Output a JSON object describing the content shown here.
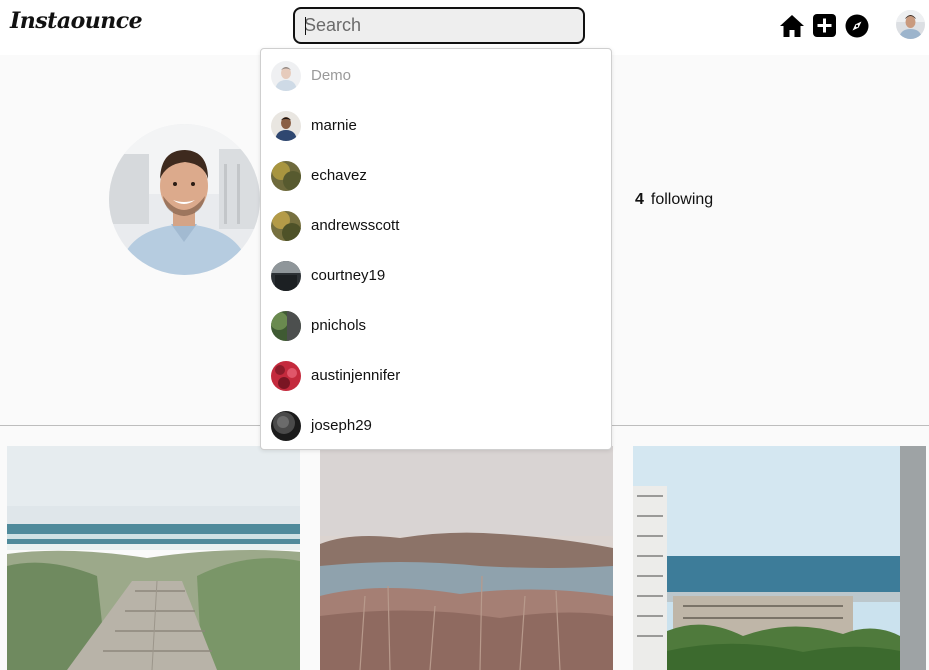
{
  "header": {
    "logo": "Instaounce",
    "search": {
      "placeholder": "Search",
      "value": ""
    },
    "nav": [
      {
        "icon": "home-icon"
      },
      {
        "icon": "add-post-icon"
      },
      {
        "icon": "explore-compass-icon"
      },
      {
        "icon": "profile-avatar"
      }
    ]
  },
  "profile": {
    "following_count": "4",
    "following_label": "following"
  },
  "search_results": [
    {
      "username": "Demo",
      "muted": true
    },
    {
      "username": "marnie"
    },
    {
      "username": "echavez"
    },
    {
      "username": "andrewsscott"
    },
    {
      "username": "courtney19"
    },
    {
      "username": "pnichols"
    },
    {
      "username": "austinjennifer"
    },
    {
      "username": "joseph29"
    }
  ],
  "posts": [
    {
      "subject": "beach boardwalk"
    },
    {
      "subject": "lake and hills"
    },
    {
      "subject": "city by the sea"
    }
  ]
}
